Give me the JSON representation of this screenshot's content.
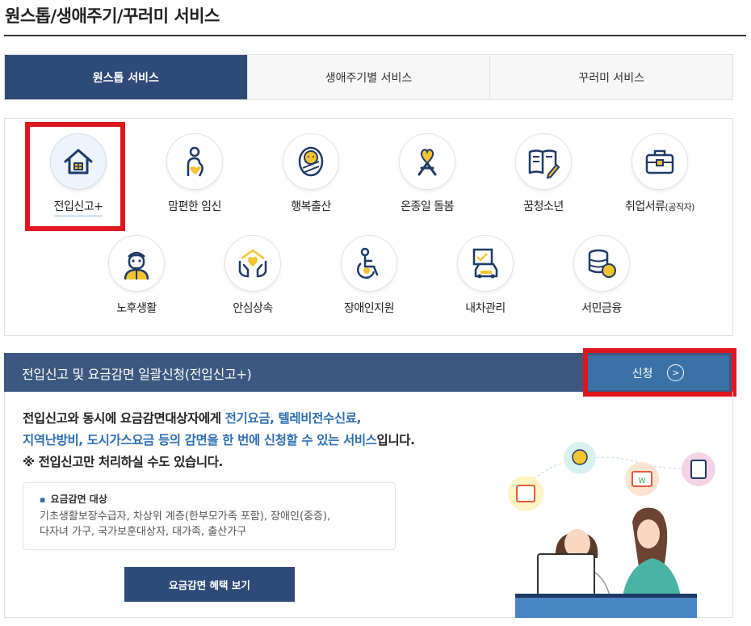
{
  "page": {
    "title": "원스톱/생애주기/꾸러미 서비스"
  },
  "tabs": [
    {
      "label": "원스톱 서비스",
      "active": true
    },
    {
      "label": "생애주기별 서비스",
      "active": false
    },
    {
      "label": "꾸러미 서비스",
      "active": false
    }
  ],
  "services": [
    {
      "label": "전입신고+",
      "icon": "house-icon",
      "selected": true
    },
    {
      "label": "맘편한 임신",
      "icon": "pregnancy-icon"
    },
    {
      "label": "행복출산",
      "icon": "baby-icon"
    },
    {
      "label": "온종일 돌봄",
      "icon": "care-ribbon-icon"
    },
    {
      "label": "꿈청소년",
      "icon": "book-pencil-icon"
    },
    {
      "label": "취업서류",
      "label_small": "(공직자)",
      "icon": "briefcase-icon"
    },
    {
      "label": "노후생활",
      "icon": "senior-icon"
    },
    {
      "label": "안심상속",
      "icon": "hands-heart-icon"
    },
    {
      "label": "장애인지원",
      "icon": "wheelchair-icon"
    },
    {
      "label": "내차관리",
      "icon": "car-document-icon"
    },
    {
      "label": "서민금융",
      "icon": "coins-icon"
    }
  ],
  "banner": {
    "title": "전입신고 및 요금감면 일괄신청(전입신고+)",
    "apply_label": "신청"
  },
  "description": {
    "line1_a": "전입신고와 동시에 요금감면대상자에게 ",
    "line1_hl": "전기요금, 텔레비전수신료,",
    "line2_hl": "지역난방비, 도시가스요금 등의 감면을 한 번에 신청할 수 있는 서비스",
    "line2_b": "입니다.",
    "line3": "※ 전입신고만 처리하실 수도 있습니다."
  },
  "target": {
    "title": "요금감면 대상",
    "line1": "기초생활보장수급자, 차상위 계층(한부모가족 포함), 장애인(중증),",
    "line2": "다자녀 가구, 국가보훈대상자, 대가족, 출산가구"
  },
  "benefit_button": "요금감면 혜택 보기",
  "illustration": {
    "icon_label": "W"
  },
  "colors": {
    "navy": "#2e4a78",
    "banner": "#3c5880",
    "apply": "#3a72a8",
    "highlight": "#2d6fb0",
    "annotation": "#e0161e"
  }
}
